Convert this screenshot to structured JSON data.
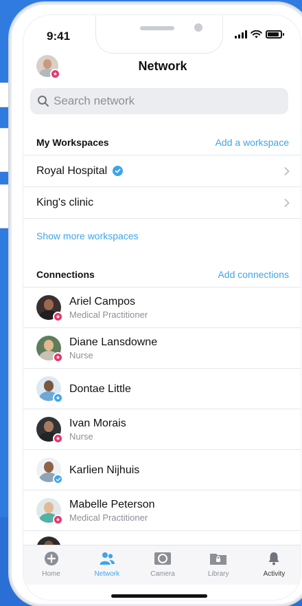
{
  "status": {
    "time": "9:41"
  },
  "header": {
    "title": "Network"
  },
  "search": {
    "placeholder": "Search network"
  },
  "workspaces": {
    "label": "My Workspaces",
    "action": "Add a workspace",
    "items": [
      {
        "name": "Royal Hospital",
        "verified": true
      },
      {
        "name": "King's clinic",
        "verified": false
      }
    ],
    "show_more": "Show more workspaces"
  },
  "connections": {
    "label": "Connections",
    "action": "Add connections",
    "items": [
      {
        "name": "Ariel Campos",
        "role": "Medical Practitioner",
        "badge": "star"
      },
      {
        "name": "Diane Lansdowne",
        "role": "Nurse",
        "badge": "star"
      },
      {
        "name": "Dontae Little",
        "role": "",
        "badge": "star-blue"
      },
      {
        "name": "Ivan Morais",
        "role": "Nurse",
        "badge": "star"
      },
      {
        "name": "Karlien Nijhuis",
        "role": "",
        "badge": "check"
      },
      {
        "name": "Mabelle Peterson",
        "role": "Medical Practitioner",
        "badge": "star"
      }
    ]
  },
  "tabbar": {
    "tabs": [
      {
        "label": "Home",
        "icon": "plus-circle-icon"
      },
      {
        "label": "Network",
        "icon": "people-icon",
        "active": true
      },
      {
        "label": "Camera",
        "icon": "camera-icon"
      },
      {
        "label": "Library",
        "icon": "folder-lock-icon"
      },
      {
        "label": "Activity",
        "icon": "bell-icon"
      }
    ]
  },
  "colors": {
    "accent": "#3da5e8",
    "badge_star": "#e8336a",
    "background": "#2f7be0"
  }
}
